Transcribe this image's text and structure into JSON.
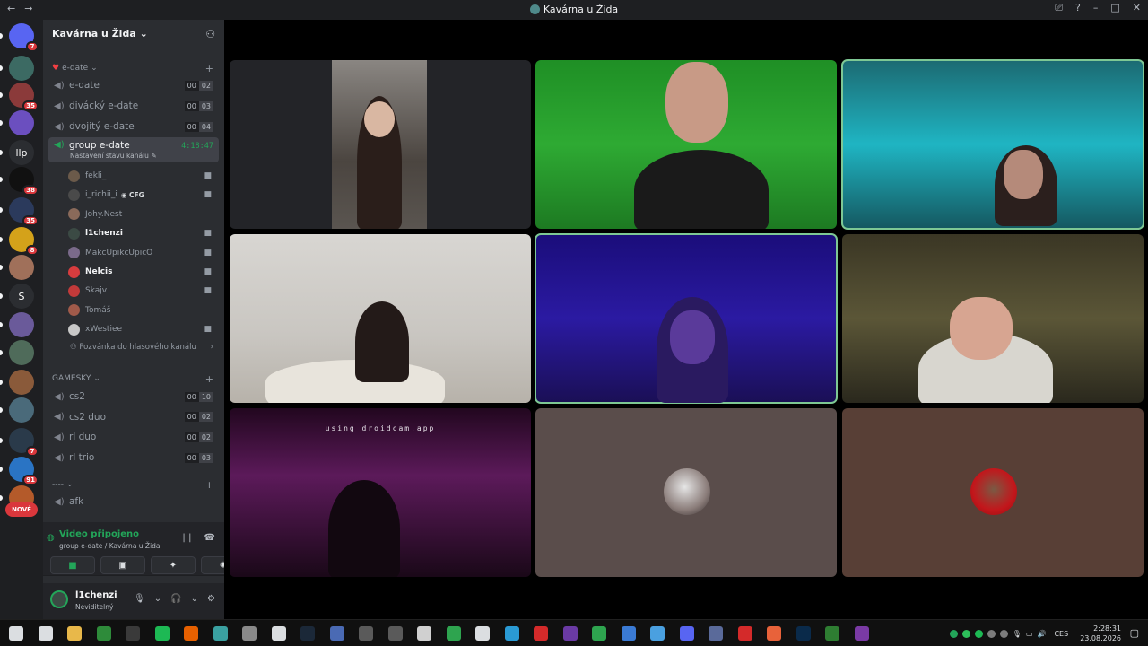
{
  "window": {
    "title": "Kavárna u Žida",
    "nav_back": "←",
    "nav_forward": "→",
    "inbox_icon": "⎚",
    "help_icon": "?",
    "min": "–",
    "max": "□",
    "close": "✕"
  },
  "rail": {
    "servers": [
      {
        "label": "",
        "badge": "7",
        "color": "#5865f2"
      },
      {
        "label": "",
        "badge": "",
        "color": "#3c6a63"
      },
      {
        "label": "",
        "badge": "35",
        "color": "#8b3a3a"
      },
      {
        "label": "",
        "badge": "",
        "color": "#6b4fbf"
      },
      {
        "label": "llp",
        "badge": "",
        "color": "#2b2d31"
      },
      {
        "label": "",
        "badge": "38",
        "color": "#111111"
      },
      {
        "label": "",
        "badge": "35",
        "color": "#2b3a5c"
      },
      {
        "label": "",
        "badge": "8",
        "color": "#d4a21a"
      },
      {
        "label": "",
        "badge": "",
        "color": "#a0705a"
      },
      {
        "label": "S",
        "badge": "",
        "color": "#2b2d31"
      },
      {
        "label": "",
        "badge": "",
        "color": "#6a5a9a"
      },
      {
        "label": "",
        "badge": "",
        "color": "#4f6b5a"
      },
      {
        "label": "",
        "badge": "",
        "color": "#8a5a3a"
      },
      {
        "label": "",
        "badge": "",
        "color": "#4a6a7a"
      },
      {
        "label": "",
        "badge": "7",
        "color": "#2a3a4a"
      },
      {
        "label": "",
        "badge": "91",
        "color": "#2a74c4"
      },
      {
        "label": "",
        "badge": "",
        "color": "#b45a2a"
      }
    ],
    "new_badge": "NOVÉ"
  },
  "sidebar": {
    "server_name": "Kavárna u Žida",
    "categories": [
      {
        "name": "e-date",
        "heart": "♥"
      },
      {
        "name": "GAMESKY"
      },
      {
        "name": "----"
      }
    ],
    "channels_edate": [
      {
        "name": "e-date",
        "c1": "00",
        "c2": "02"
      },
      {
        "name": "divácký e-date",
        "c1": "00",
        "c2": "03"
      },
      {
        "name": "dvojitý e-date",
        "c1": "00",
        "c2": "04"
      }
    ],
    "active_channel": {
      "name": "group e-date",
      "timer": "4:18:47",
      "status": "Nastavení stavu kanálu ✎"
    },
    "users": [
      {
        "name": "fekli_",
        "bold": false,
        "cam": true,
        "tag": "",
        "color": "#6b5a4a"
      },
      {
        "name": "i_richii_i",
        "bold": false,
        "cam": true,
        "tag": "CFG",
        "color": "#4a4a4a"
      },
      {
        "name": "Johy.Nest",
        "bold": false,
        "cam": false,
        "tag": "",
        "color": "#8a6a5a"
      },
      {
        "name": "l1chenzi",
        "bold": true,
        "cam": true,
        "tag": "",
        "color": "#3b4a44"
      },
      {
        "name": "MakcUpikcUpicO",
        "bold": false,
        "cam": true,
        "tag": "",
        "color": "#7a6a8a"
      },
      {
        "name": "Nelcis",
        "bold": true,
        "cam": true,
        "tag": "",
        "color": "#d83c3e"
      },
      {
        "name": "Skajv",
        "bold": false,
        "cam": true,
        "tag": "",
        "color": "#c23a3a"
      },
      {
        "name": "Tomáš",
        "bold": false,
        "cam": false,
        "tag": "",
        "color": "#a05a4a"
      },
      {
        "name": "xWestiee",
        "bold": false,
        "cam": true,
        "tag": "",
        "color": "#c8c8c8"
      }
    ],
    "invite_channel": "Pozvánka do hlasového kanálu",
    "channels_gamesky": [
      {
        "name": "cs2",
        "c1": "00",
        "c2": "10"
      },
      {
        "name": "cs2 duo",
        "c1": "00",
        "c2": "02"
      },
      {
        "name": "rl duo",
        "c1": "00",
        "c2": "02"
      },
      {
        "name": "rl trio",
        "c1": "00",
        "c2": "03"
      }
    ],
    "channel_afk": "afk"
  },
  "voice": {
    "status": "Video připojeno",
    "location": "group e-date / Kavárna u Žida",
    "buttons": [
      "camera",
      "screen-share",
      "activities",
      "soundboard"
    ]
  },
  "user": {
    "name": "l1chenzi",
    "status": "Neviditelný"
  },
  "stage": {
    "droidcam_text": "using droidcam.app"
  },
  "tray": {
    "language": "CES",
    "time": "2:28:31",
    "date": "23.08.2026"
  }
}
